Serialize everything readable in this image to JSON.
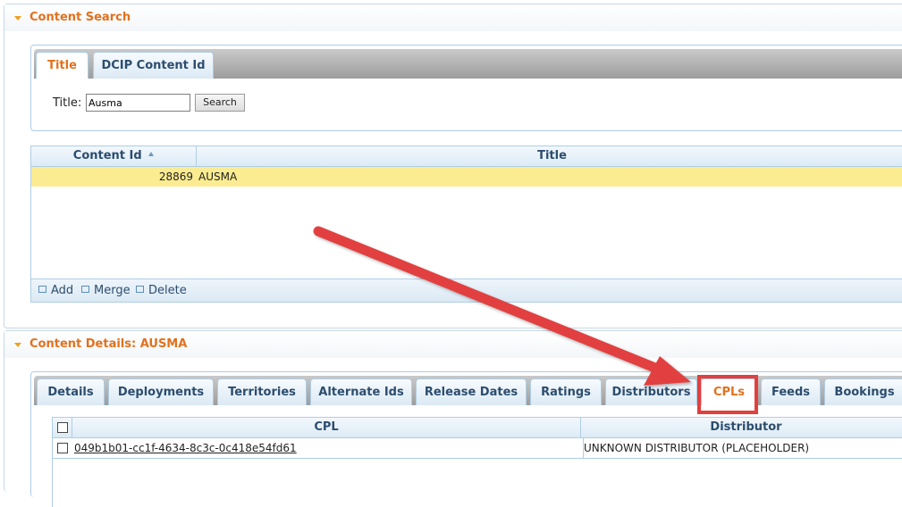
{
  "content_search": {
    "header": "Content Search",
    "tabs": [
      {
        "label": "Title",
        "active": true
      },
      {
        "label": "DCIP Content Id",
        "active": false
      }
    ],
    "title_label": "Title:",
    "title_value": "Ausma",
    "search_button": "Search",
    "grid": {
      "columns": [
        "Content Id",
        "Title"
      ],
      "rows": [
        {
          "content_id": "28869",
          "title": "AUSMA"
        }
      ],
      "footer": {
        "add": "Add",
        "merge": "Merge",
        "delete": "Delete"
      }
    }
  },
  "content_details": {
    "header": "Content Details: AUSMA",
    "tabs": [
      {
        "label": "Details"
      },
      {
        "label": "Deployments"
      },
      {
        "label": "Territories"
      },
      {
        "label": "Alternate Ids"
      },
      {
        "label": "Release Dates"
      },
      {
        "label": "Ratings"
      },
      {
        "label": "Distributors"
      },
      {
        "label": "CPLs",
        "active": true
      },
      {
        "label": "Feeds"
      },
      {
        "label": "Bookings"
      }
    ],
    "grid": {
      "columns": [
        "CPL",
        "Distributor"
      ],
      "rows": [
        {
          "cpl": "049b1b01-cc1f-4634-8c3c-0c418e54fd61",
          "distributor": "UNKNOWN DISTRIBUTOR (PLACEHOLDER)"
        }
      ]
    }
  },
  "colors": {
    "header_orange": "#e2711d",
    "tab_text": "#2c4d6e",
    "selected_row": "#fbec91",
    "annotation_red": "#e23f3f"
  }
}
